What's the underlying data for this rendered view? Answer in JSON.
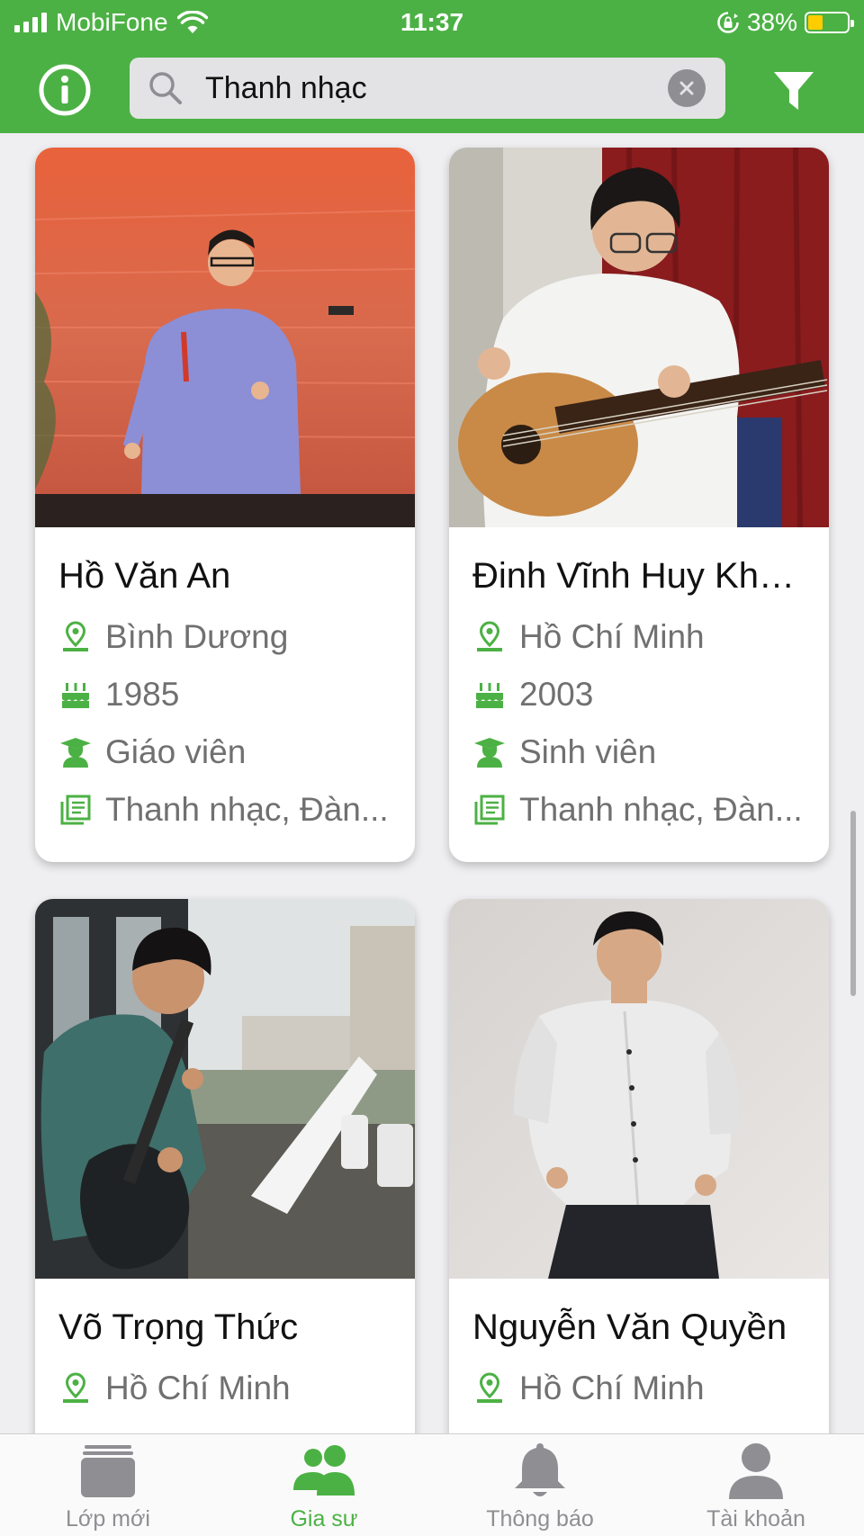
{
  "status_bar": {
    "carrier": "MobiFone",
    "time": "11:37",
    "battery_percent": "38%",
    "battery_level": 0.38,
    "icons": [
      "signal-icon",
      "wifi-icon",
      "rotation-lock-icon",
      "battery-icon"
    ]
  },
  "header": {
    "search_query": "Thanh nhạc",
    "icons": [
      "info-icon",
      "search-icon",
      "clear-icon",
      "filter-icon"
    ]
  },
  "tutors": [
    {
      "name": "Hồ Văn An",
      "location": "Bình Dương",
      "birth_year": "1985",
      "occupation": "Giáo viên",
      "subjects": "Thanh nhạc, Đàn..."
    },
    {
      "name": "Đinh Vĩnh Huy Kha...",
      "location": "Hồ Chí Minh",
      "birth_year": "2003",
      "occupation": "Sinh viên",
      "subjects": "Thanh nhạc, Đàn..."
    },
    {
      "name": "Võ Trọng Thức",
      "location": "Hồ Chí Minh",
      "birth_year": "",
      "occupation": "",
      "subjects": ""
    },
    {
      "name": "Nguyễn Văn Quyền",
      "location": "Hồ Chí Minh",
      "birth_year": "",
      "occupation": "",
      "subjects": ""
    }
  ],
  "tabbar": {
    "tabs": [
      {
        "label": "Lớp mới",
        "icon": "classes-icon",
        "active": false
      },
      {
        "label": "Gia sư",
        "icon": "tutors-icon",
        "active": true
      },
      {
        "label": "Thông báo",
        "icon": "bell-icon",
        "active": false
      },
      {
        "label": "Tài khoản",
        "icon": "account-icon",
        "active": false
      }
    ]
  },
  "colors": {
    "brand_green": "#4cb144",
    "inactive_gray": "#8e8e93",
    "text_secondary": "#707070",
    "battery_yellow": "#ffcc00"
  }
}
